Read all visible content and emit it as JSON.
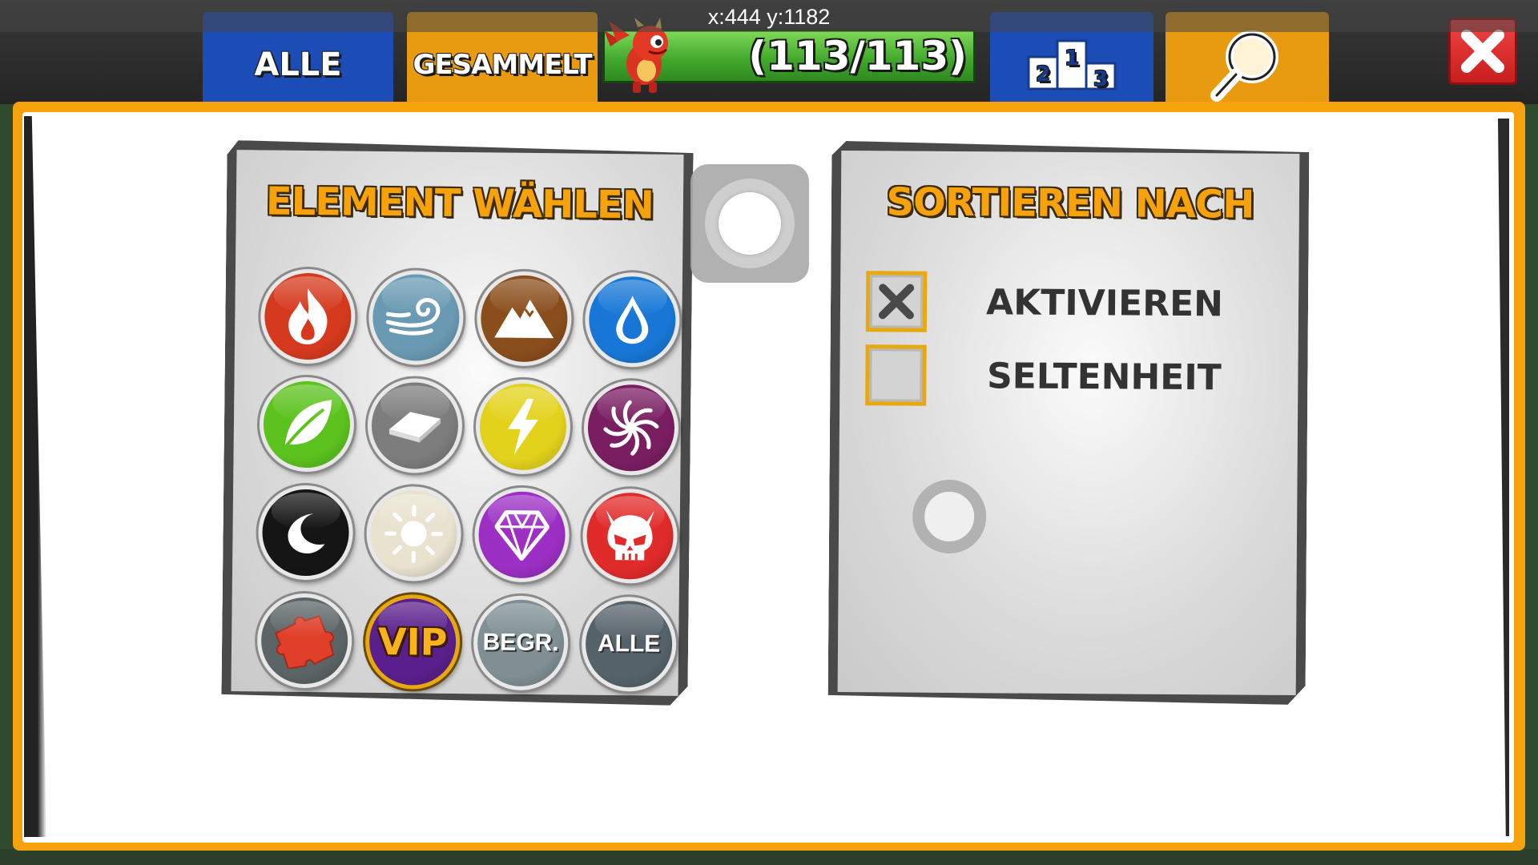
{
  "debug_overlay": {
    "coords": "x:444 y:1182"
  },
  "header": {
    "tab_all": "ALLE",
    "tab_collected": "GESAMMELT",
    "progress": {
      "text": "(113/113)",
      "current": 113,
      "total": 113
    },
    "leaderboard_icon": "podium-icon",
    "search_icon": "search-icon",
    "close_icon": "close-icon"
  },
  "element_panel": {
    "title": "ELEMENT WÄHLEN",
    "elements": [
      {
        "name": "fire",
        "icon": "flame-icon",
        "color": "#d63a1e"
      },
      {
        "name": "wind",
        "icon": "swirl-icon",
        "color": "#6a9ab3"
      },
      {
        "name": "earth",
        "icon": "mountain-icon",
        "color": "#8a4e1c"
      },
      {
        "name": "water",
        "icon": "droplet-icon",
        "color": "#1877d6"
      },
      {
        "name": "plant",
        "icon": "leaf-icon",
        "color": "#5cc21e"
      },
      {
        "name": "metal",
        "icon": "metal-bar-icon",
        "color": "#7d7d7d"
      },
      {
        "name": "energy",
        "icon": "lightning-icon",
        "color": "#e3d21b"
      },
      {
        "name": "void",
        "icon": "spiral-icon",
        "color": "#7a1e62"
      },
      {
        "name": "dark",
        "icon": "moon-icon",
        "color": "#151515"
      },
      {
        "name": "light",
        "icon": "sun-icon",
        "color": "#e8e2cf"
      },
      {
        "name": "pure",
        "icon": "diamond-icon",
        "color": "#9c2fc4"
      },
      {
        "name": "legend",
        "icon": "skull-icon",
        "color": "#e12a2a"
      },
      {
        "name": "puzzle",
        "icon": "puzzle-icon",
        "color": "#5b6466"
      },
      {
        "name": "vip",
        "label": "VIP",
        "icon": "vip-icon",
        "color": "#5a1f8c"
      },
      {
        "name": "limited",
        "label": "BEGR.",
        "icon": "clock-icon",
        "color": "#7f8f93"
      },
      {
        "name": "all",
        "label": "ALLE",
        "icon": "all-icon",
        "color": "#56626a"
      }
    ]
  },
  "sort_panel": {
    "title": "SORTIEREN NACH",
    "options": [
      {
        "label": "AKTIVIEREN",
        "checked": true
      },
      {
        "label": "SELTENHEIT",
        "checked": false
      }
    ]
  }
}
